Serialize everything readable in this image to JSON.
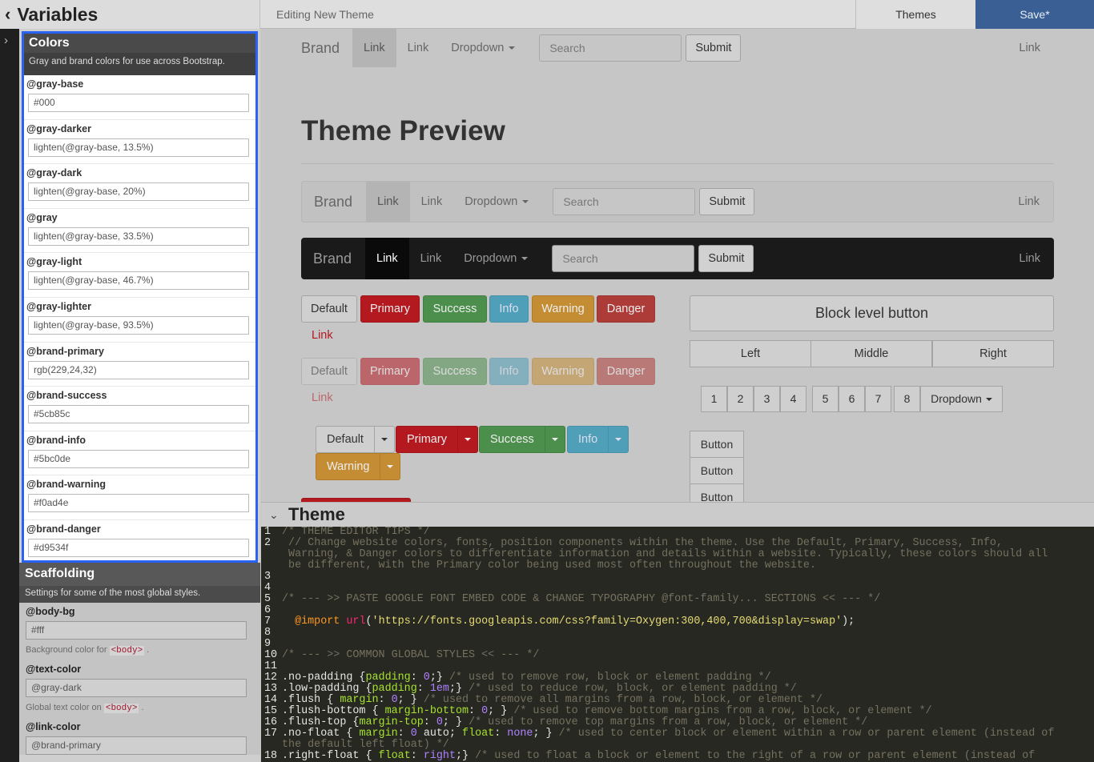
{
  "topbar": {
    "title": "Variables",
    "editing": "Editing New Theme",
    "themes": "Themes",
    "save": "Save*"
  },
  "sidebar": {
    "colors": {
      "title": "Colors",
      "desc": "Gray and brand colors for use across Bootstrap.",
      "vars": [
        {
          "name": "@gray-base",
          "value": "#000"
        },
        {
          "name": "@gray-darker",
          "value": "lighten(@gray-base, 13.5%)"
        },
        {
          "name": "@gray-dark",
          "value": "lighten(@gray-base, 20%)"
        },
        {
          "name": "@gray",
          "value": "lighten(@gray-base, 33.5%)"
        },
        {
          "name": "@gray-light",
          "value": "lighten(@gray-base, 46.7%)"
        },
        {
          "name": "@gray-lighter",
          "value": "lighten(@gray-base, 93.5%)"
        },
        {
          "name": "@brand-primary",
          "value": "rgb(229,24,32)"
        },
        {
          "name": "@brand-success",
          "value": "#5cb85c"
        },
        {
          "name": "@brand-info",
          "value": "#5bc0de"
        },
        {
          "name": "@brand-warning",
          "value": "#f0ad4e"
        },
        {
          "name": "@brand-danger",
          "value": "#d9534f"
        }
      ]
    },
    "scaffolding": {
      "title": "Scaffolding",
      "desc": "Settings for some of the most global styles.",
      "vars": [
        {
          "name": "@body-bg",
          "value": "#fff",
          "help_pre": "Background color for",
          "help_code": "<body>",
          "help_post": "."
        },
        {
          "name": "@text-color",
          "value": "@gray-dark",
          "help_pre": "Global text color on",
          "help_code": "<body>",
          "help_post": "."
        },
        {
          "name": "@link-color",
          "value": "@brand-primary"
        }
      ]
    }
  },
  "preview": {
    "nav": {
      "brand": "Brand",
      "link1": "Link",
      "link2": "Link",
      "dropdown": "Dropdown",
      "search_placeholder": "Search",
      "submit": "Submit",
      "right_link": "Link"
    },
    "title": "Theme Preview",
    "buttons": {
      "default": "Default",
      "primary": "Primary",
      "success": "Success",
      "info": "Info",
      "warning": "Warning",
      "danger": "Danger",
      "link": "Link"
    },
    "block_button": "Block level button",
    "justified": [
      "Left",
      "Middle",
      "Right"
    ],
    "pagination": [
      "1",
      "2",
      "3",
      "4",
      "5",
      "6",
      "7",
      "8"
    ],
    "pagination_dropdown": "Dropdown",
    "vertical_button": "Button"
  },
  "theme": {
    "title": "Theme",
    "lines": [
      {
        "n": "1",
        "t": "/* THEME EDITOR TIPS */"
      },
      {
        "n": "2",
        "t": " // Change website colors, fonts, position components within the theme. Use the Default, Primary, Success, Info,\n Warning, & Danger colors to differentiate information and details within a website. Typically, these colors should all\n be different, with the Primary color being used most often throughout the website."
      },
      {
        "n": "3",
        "t": ""
      },
      {
        "n": "4",
        "t": ""
      },
      {
        "n": "5",
        "t": "/* --- >> PASTE GOOGLE FONT EMBED CODE & CHANGE TYPOGRAPHY @font-family... SECTIONS << --- */"
      },
      {
        "n": "6",
        "t": ""
      },
      {
        "n": "7",
        "t": "  @import url('https://fonts.googleapis.com/css?family=Oxygen:300,400,700&display=swap');"
      },
      {
        "n": "8",
        "t": ""
      },
      {
        "n": "9",
        "t": ""
      },
      {
        "n": "10",
        "t": "/* --- >> COMMON GLOBAL STYLES << --- */"
      },
      {
        "n": "11",
        "t": ""
      },
      {
        "n": "12",
        "t": ".no-padding {padding: 0;} /* used to remove row, block or element padding */"
      },
      {
        "n": "13",
        "t": ".low-padding {padding: 1em;} /* used to reduce row, block, or element padding */"
      },
      {
        "n": "14",
        "t": ".flush { margin: 0; } /* used to remove all margins from a row, block, or element */"
      },
      {
        "n": "15",
        "t": ".flush-bottom { margin-bottom:0; } /* used to remove bottom margins from a row, block, or element */"
      },
      {
        "n": "16",
        "t": ".flush-top {margin-top: 0; } /* used to remove top margins from a row, block, or element */"
      },
      {
        "n": "17",
        "t": ".no-float { margin: 0 auto; float: none; } /* used to center block or element within a row or parent element (instead of\nthe default left float) */"
      },
      {
        "n": "18",
        "t": ".right-float { float: right;} /* used to float a block or element to the right of a row or parent element (instead of"
      }
    ]
  }
}
